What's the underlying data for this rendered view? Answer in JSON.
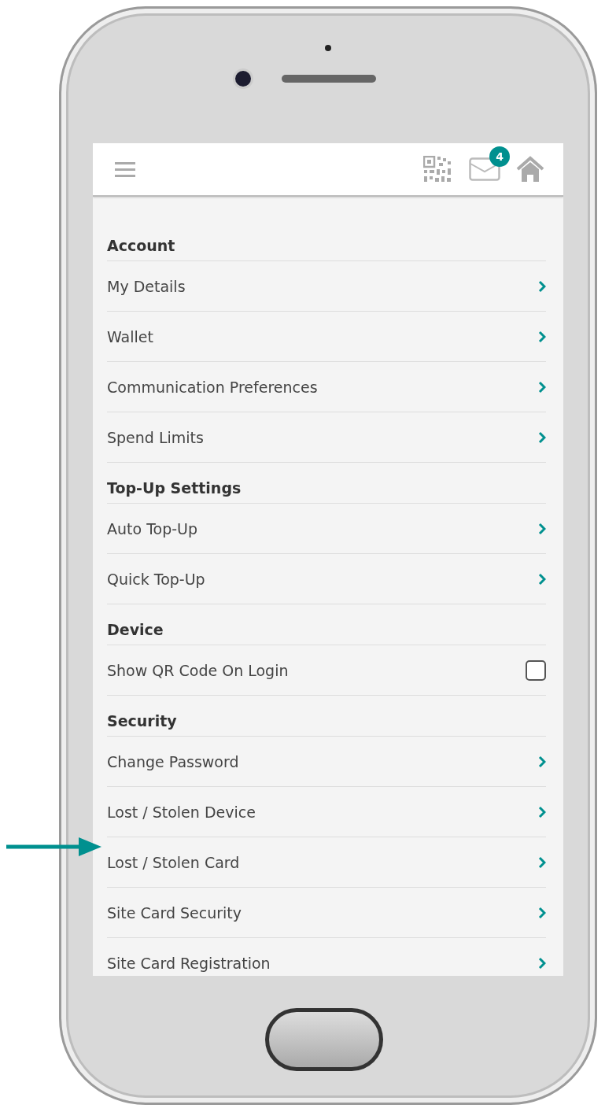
{
  "header": {
    "mail_badge": "4"
  },
  "menu": [
    {
      "kind": "section",
      "label": "Account"
    },
    {
      "kind": "link",
      "label": "My Details"
    },
    {
      "kind": "link",
      "label": "Wallet"
    },
    {
      "kind": "link",
      "label": "Communication Preferences"
    },
    {
      "kind": "link",
      "label": "Spend Limits"
    },
    {
      "kind": "section",
      "label": "Top-Up Settings"
    },
    {
      "kind": "link",
      "label": "Auto Top-Up"
    },
    {
      "kind": "link",
      "label": "Quick Top-Up"
    },
    {
      "kind": "section",
      "label": "Device"
    },
    {
      "kind": "checkbox",
      "label": "Show QR Code On Login",
      "checked": false
    },
    {
      "kind": "section",
      "label": "Security"
    },
    {
      "kind": "link",
      "label": "Change Password"
    },
    {
      "kind": "link",
      "label": "Lost / Stolen Device"
    },
    {
      "kind": "link",
      "label": "Lost / Stolen Card"
    },
    {
      "kind": "link",
      "label": "Site Card Security"
    },
    {
      "kind": "link",
      "label": "Site Card Registration"
    }
  ]
}
